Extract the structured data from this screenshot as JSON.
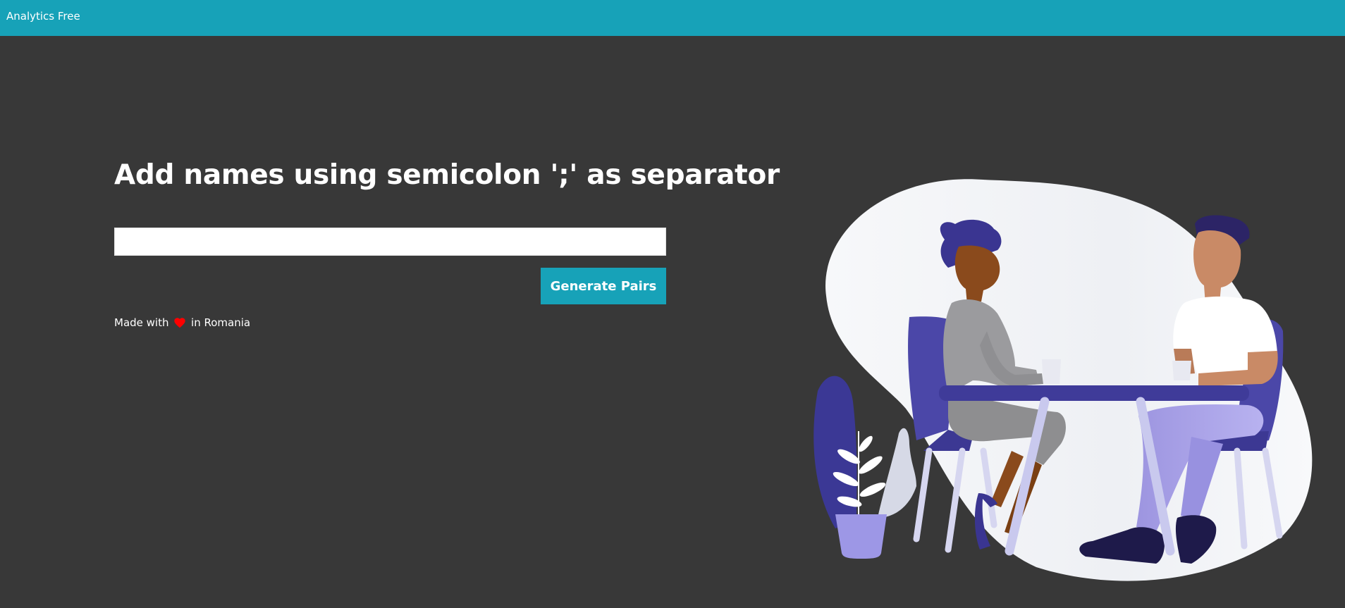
{
  "navbar": {
    "brand": "Analytics Free",
    "color": "#17a2b8"
  },
  "main": {
    "heading": "Add names using semicolon ';' as separator",
    "names_input": {
      "value": "",
      "placeholder": ""
    },
    "generate_button_label": "Generate Pairs",
    "footer": {
      "prefix": "Made with",
      "icon": "heart-icon",
      "suffix": "in Romania"
    }
  },
  "illustration": {
    "icon": "two-people-at-table-illustration"
  },
  "colors": {
    "background": "#383838",
    "accent": "#17a2b8",
    "heart": "#ff0000"
  }
}
